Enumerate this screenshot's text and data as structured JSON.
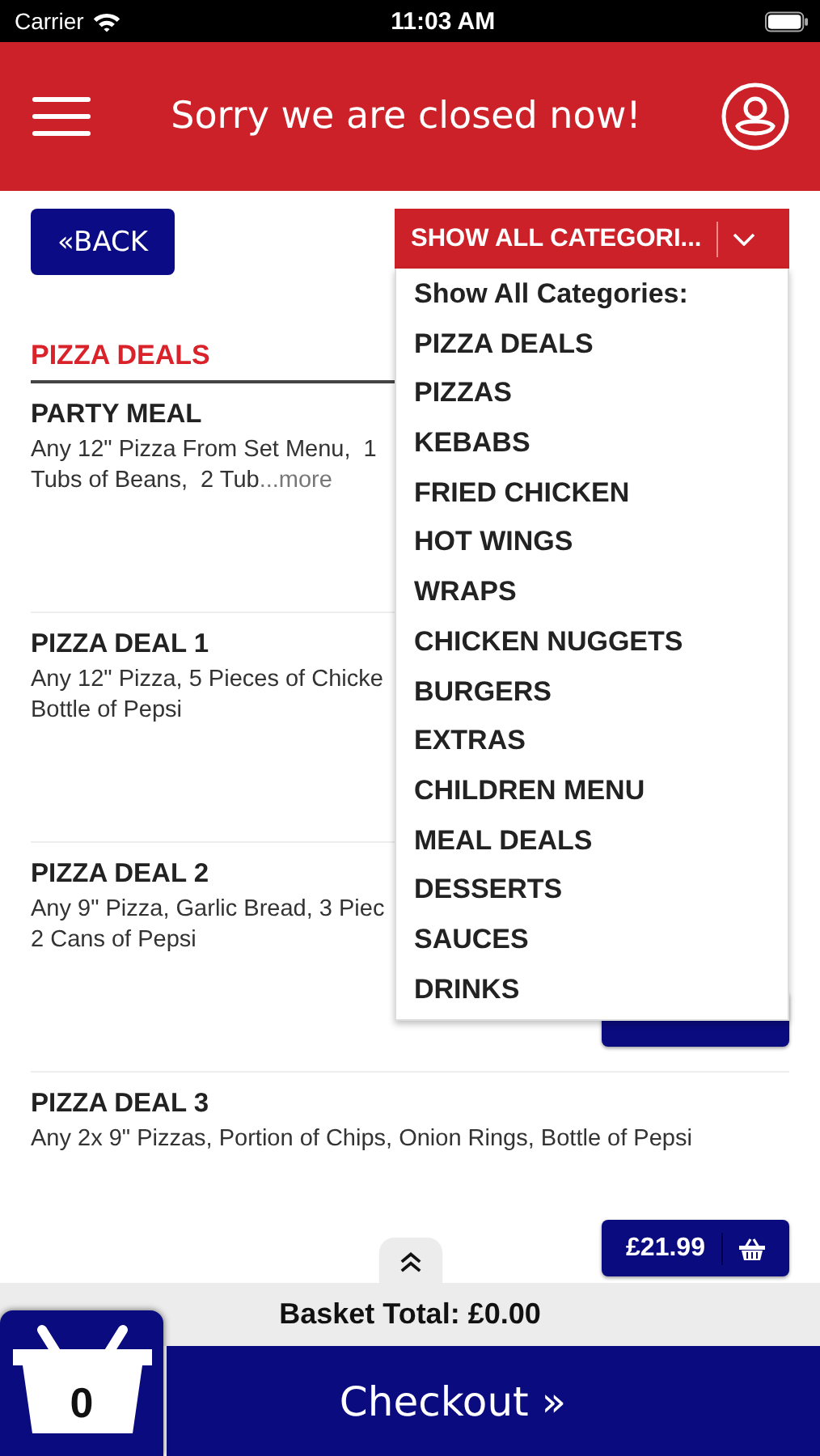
{
  "status_bar": {
    "carrier": "Carrier",
    "time": "11:03 AM"
  },
  "header": {
    "title": "Sorry we are closed now!"
  },
  "back_button": {
    "label": "«BACK"
  },
  "category_dropdown": {
    "value": "SHOW ALL CATEGORI...",
    "expanded": true,
    "options": [
      {
        "label": "Show All Categories:"
      },
      {
        "label": "PIZZA DEALS"
      },
      {
        "label": "PIZZAS"
      },
      {
        "label": "KEBABS"
      },
      {
        "label": "FRIED CHICKEN"
      },
      {
        "label": "HOT WINGS"
      },
      {
        "label": "WRAPS"
      },
      {
        "label": "CHICKEN NUGGETS"
      },
      {
        "label": "BURGERS"
      },
      {
        "label": "EXTRAS"
      },
      {
        "label": "CHILDREN MENU"
      },
      {
        "label": "MEAL DEALS"
      },
      {
        "label": "DESSERTS"
      },
      {
        "label": "SAUCES"
      },
      {
        "label": "DRINKS"
      }
    ]
  },
  "section": {
    "title": "PIZZA DEALS"
  },
  "items": [
    {
      "name": "PARTY MEAL",
      "description_lines": [
        "Any 12\" Pizza From Set Menu,  1",
        "Tubs of Beans,  2 Tub"
      ],
      "more_link": "...more"
    },
    {
      "name": "PIZZA DEAL 1",
      "description_lines": [
        "Any 12\" Pizza, 5 Pieces of Chicke",
        "Bottle of Pepsi"
      ]
    },
    {
      "name": "PIZZA DEAL 2",
      "description_lines": [
        "Any 9\" Pizza, Garlic Bread, 3 Piec",
        "2 Cans of Pepsi"
      ],
      "basket_button": true
    },
    {
      "name": "PIZZA DEAL 3",
      "description_lines": [
        "Any 2x 9\" Pizzas, Portion of Chips, Onion Rings, Bottle of Pepsi"
      ],
      "price": "£21.99"
    }
  ],
  "basket": {
    "total": "Basket Total: £0.00",
    "count": "0",
    "checkout": "Checkout »"
  }
}
